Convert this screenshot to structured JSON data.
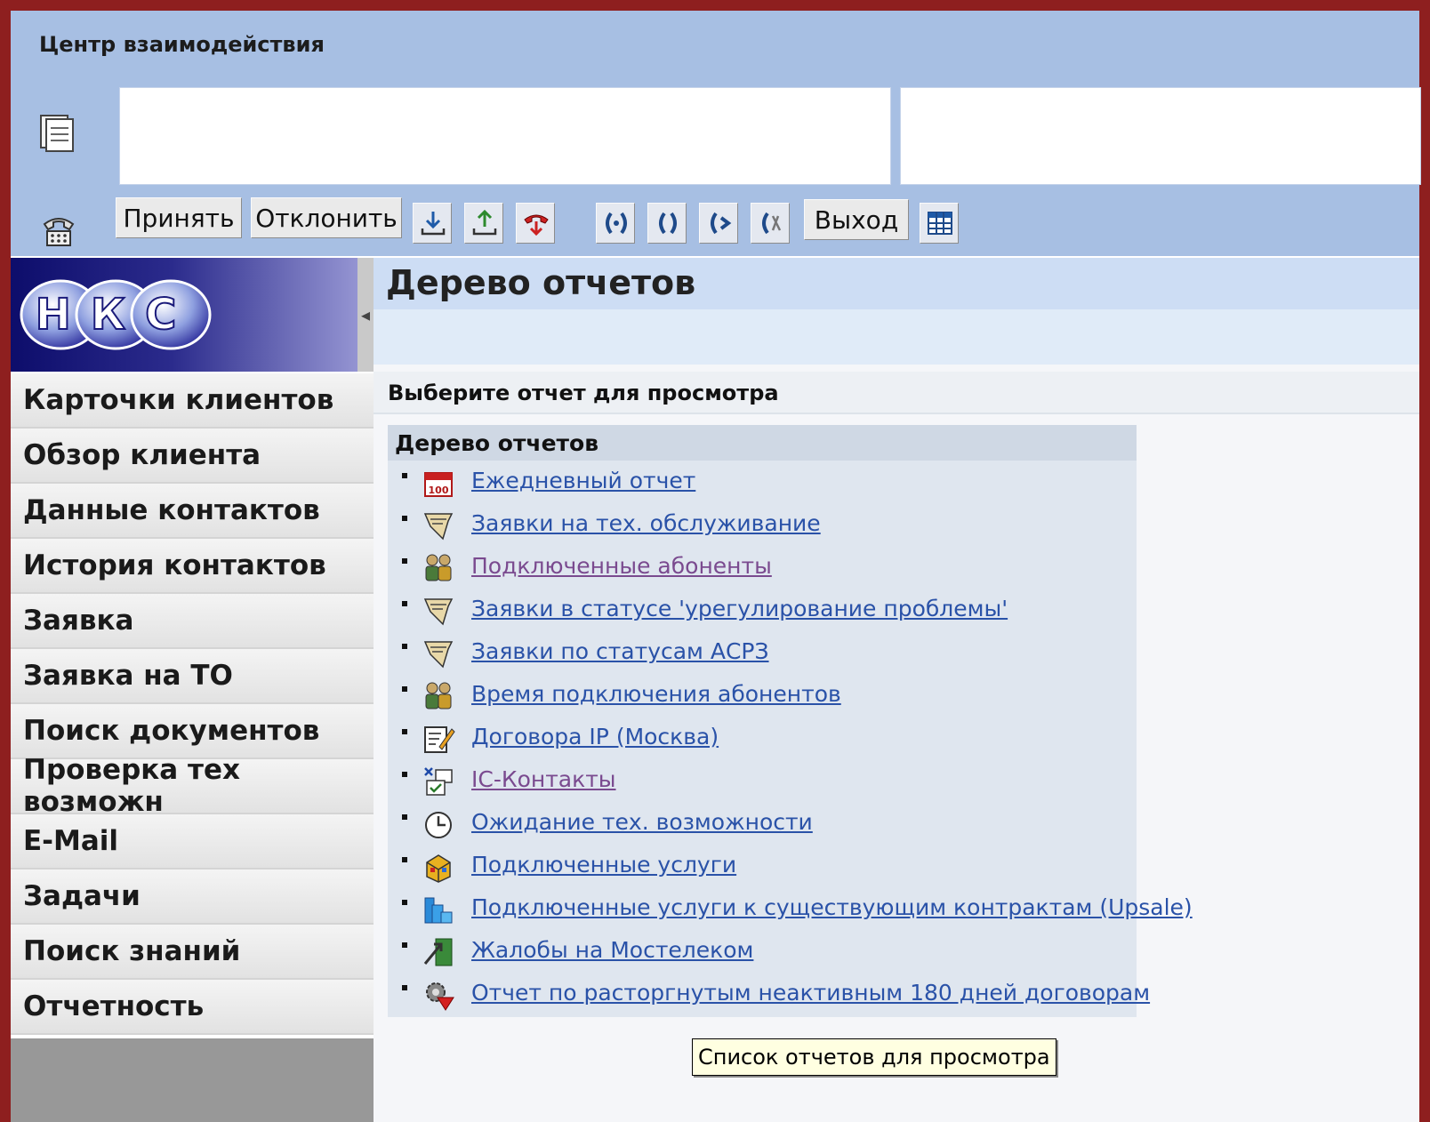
{
  "interaction_center": {
    "title": "Центр взаимодействия",
    "buttons": {
      "accept": "Принять",
      "reject": "Отклонить",
      "exit": "Выход"
    }
  },
  "logo": {
    "text": "НКС",
    "collapse_arrow": "◂"
  },
  "nav": {
    "items": [
      {
        "label": "Карточки клиентов"
      },
      {
        "label": "Обзор клиента"
      },
      {
        "label": "Данные контактов"
      },
      {
        "label": "История контактов"
      },
      {
        "label": "Заявка"
      },
      {
        "label": "Заявка на ТО"
      },
      {
        "label": "Поиск документов"
      },
      {
        "label": "Проверка тех возможн"
      },
      {
        "label": "E-Mail"
      },
      {
        "label": "Задачи"
      },
      {
        "label": "Поиск знаний"
      },
      {
        "label": "Отчетность"
      }
    ]
  },
  "content": {
    "title": "Дерево отчетов",
    "section_title": "Выберите отчет для просмотра",
    "tree_title": "Дерево отчетов",
    "reports": [
      {
        "label": "Ежедневный отчет",
        "icon": "calendar-report-icon"
      },
      {
        "label": "Заявки на тех. обслуживание",
        "icon": "request-note-icon"
      },
      {
        "label": "Подключенные абоненты",
        "icon": "subscribers-icon"
      },
      {
        "label": "Заявки в статусе 'урегулирование проблемы'",
        "icon": "request-note-icon"
      },
      {
        "label": "Заявки по статусам АСРЗ",
        "icon": "request-note-icon"
      },
      {
        "label": "Время подключения абонентов",
        "icon": "subscribers-icon"
      },
      {
        "label": "Договора IP (Москва)",
        "icon": "contract-edit-icon"
      },
      {
        "label": "IC-Контакты",
        "icon": "contacts-icon"
      },
      {
        "label": "Ожидание тех. возможности",
        "icon": "clock-icon"
      },
      {
        "label": "Подключенные услуги",
        "icon": "services-box-icon"
      },
      {
        "label": "Подключенные услуги к существующим контрактам (Upsale)",
        "icon": "upsale-chart-icon"
      },
      {
        "label": "Жалобы на Мостелеком",
        "icon": "complaint-flag-icon"
      },
      {
        "label": "Отчет по расторгнутым неактивным 180 дней договорам",
        "icon": "terminated-gear-icon"
      }
    ],
    "tooltip": "Список отчетов для просмотра"
  }
}
